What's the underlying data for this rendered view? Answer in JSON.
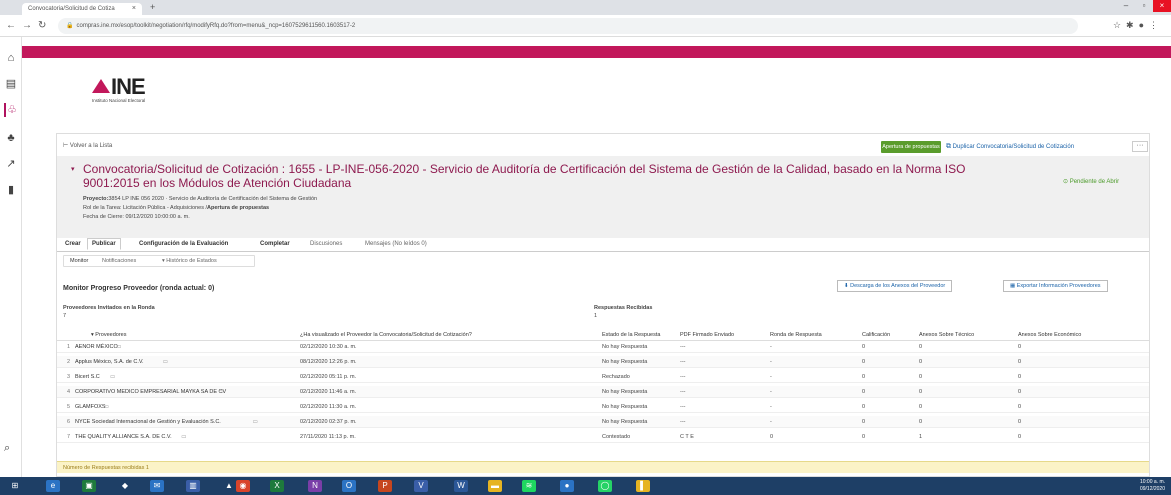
{
  "browser": {
    "tab_title": "Convocatoria/Solicitud de Cotiza",
    "url": "compras.ine.mx/esop/toolkit/negotiation/rfq/modifyRfq.do?from=menu&_ncp=1607529611560.1603517-2",
    "close_glyph": "×",
    "newtab_glyph": "+"
  },
  "logo": {
    "mark": "INE",
    "subtitle": "Instituto Nacional Electoral"
  },
  "toolbar": {
    "back_label": "Volver a la Lista",
    "apertura_label": "Apertura de propuestas",
    "duplicar_label": "Duplicar Convocatoria/Solicitud de Cotización",
    "more_label": "···"
  },
  "header": {
    "title": "Convocatoria/Solicitud de Cotización : 1655 - LP-INE-056-2020 - Servicio de Auditoría de Certificación del Sistema de Gestión de la Calidad, basado en la Norma ISO 9001:2015 en los Módulos de Atención Ciudadana",
    "proyecto_label": "Proyecto:",
    "proyecto_value": "3854 LP INE 056 2020 · Servicio de Auditoría de Certificación del Sistema de Gestión",
    "rol_label": "Rol de la Tarea:",
    "rol_value": "Licitación Pública - Adquisiciones /",
    "rol_bold": "Apertura de propuestas",
    "fecha_label": "Fecha de Cierre:",
    "fecha_value": "09/12/2020 10:00:00 a. m.",
    "status": "Pendiente de Abrir"
  },
  "tabs": [
    "Crear",
    "Publicar",
    "Configuración de la Evaluación",
    "Completar",
    "Discusiones",
    "Mensajes (No leídos 0)"
  ],
  "subtabs": [
    "Monitor",
    "Notificaciones",
    "Histórico de Estados"
  ],
  "monitor": {
    "title": "Monitor Progreso Proveedor (ronda actual: 0)",
    "descarga_label": "Descarga de los Anexos del Proveedor",
    "exportar_label": "Exportar Información Proveedores",
    "invitados_label": "Proveedores Invitados en la Ronda",
    "invitados_value": "7",
    "respuestas_label": "Respuestas Recibidas",
    "respuestas_value": "1"
  },
  "table": {
    "headers": [
      "Proveedores",
      "¿Ha visualizado el Proveedor la Convocatoria/Solicitud de Cotización?",
      "Estado de la Respuesta",
      "PDF Firmado Enviado",
      "Ronda de Respuesta",
      "Calificación",
      "Anexos Sobre Técnico",
      "Anexos Sobre Económico"
    ],
    "rows": [
      {
        "n": "1",
        "prov": "AENOR MÉXICO",
        "vis": "02/12/2020 10:30 a. m.",
        "estado": "No hay Respuesta",
        "pdf": "---",
        "ronda": "-",
        "cal": "0",
        "tec": "0",
        "eco": "0"
      },
      {
        "n": "2",
        "prov": "Applus México, S.A. de C.V.",
        "vis": "08/12/2020 12:26 p. m.",
        "estado": "No hay Respuesta",
        "pdf": "---",
        "ronda": "-",
        "cal": "0",
        "tec": "0",
        "eco": "0"
      },
      {
        "n": "3",
        "prov": "Bicert S.C",
        "vis": "02/12/2020 05:11 p. m.",
        "estado": "Rechazado",
        "pdf": "---",
        "ronda": "-",
        "cal": "0",
        "tec": "0",
        "eco": "0"
      },
      {
        "n": "4",
        "prov": "CORPORATIVO MEDICO EMPRESARIAL MAYKA SA DE CV",
        "vis": "02/12/2020 11:46 a. m.",
        "estado": "No hay Respuesta",
        "pdf": "---",
        "ronda": "-",
        "cal": "0",
        "tec": "0",
        "eco": "0"
      },
      {
        "n": "5",
        "prov": "GLAMFOXS",
        "vis": "02/12/2020 11:30 a. m.",
        "estado": "No hay Respuesta",
        "pdf": "---",
        "ronda": "-",
        "cal": "0",
        "tec": "0",
        "eco": "0"
      },
      {
        "n": "6",
        "prov": "NYCE Sociedad Internacional de Gestión y Evaluación S.C.",
        "vis": "02/12/2020 02:37 p. m.",
        "estado": "No hay Respuesta",
        "pdf": "---",
        "ronda": "-",
        "cal": "0",
        "tec": "0",
        "eco": "0"
      },
      {
        "n": "7",
        "prov": "THE QUALITY ALLIANCE S.A. DE C.V.",
        "vis": "27/11/2020 11:13 p. m.",
        "estado": "Contestado",
        "pdf": "C T E",
        "ronda": "0",
        "cal": "0",
        "tec": "1",
        "eco": "0"
      }
    ],
    "footer": "Número de Respuestas recibidas 1"
  },
  "taskbar": {
    "time": "10:00 a. m.",
    "date": "09/12/2020"
  },
  "colors": {
    "brand": "#c2185b",
    "title": "#8e1a4f",
    "green": "#5a9c2c",
    "link": "#1a62a8"
  }
}
